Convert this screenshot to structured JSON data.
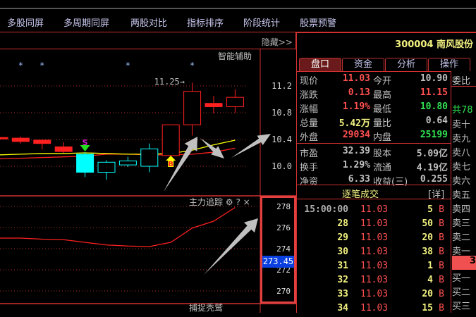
{
  "menu": [
    "多股同屏",
    "多周期同屏",
    "两股对比",
    "指标排序",
    "阶段统计",
    "股票预警"
  ],
  "hide_label": "隐藏>>",
  "main_chart": {
    "indicator_label": "智能辅助",
    "max_label": "11.25→",
    "signal_sell": "S",
    "signal_buy": "B",
    "colors": {
      "up": "#ff2020",
      "down": "#00ffff",
      "ma1": "#ffff00",
      "ma2": "#ff2020",
      "grid": "#b03030",
      "annot": "#c0c0c0"
    }
  },
  "chart_data": [
    {
      "type": "candlestick",
      "title": "智能辅助",
      "y_ticks": [
        "11.2",
        "10.8",
        "10.4",
        "10.0"
      ],
      "y_tick_values": [
        11.2,
        10.8,
        10.4,
        10.0
      ],
      "ylim": [
        9.73,
        11.72
      ],
      "candles": [
        {
          "o": 10.41,
          "h": 10.43,
          "l": 10.41,
          "c": 10.43,
          "color": "up",
          "filled": true
        },
        {
          "o": 10.37,
          "h": 10.44,
          "l": 10.34,
          "c": 10.42,
          "color": "up",
          "filled": true
        },
        {
          "o": 10.34,
          "h": 10.39,
          "l": 10.25,
          "c": 10.39,
          "color": "up",
          "filled": true
        },
        {
          "o": 10.22,
          "h": 10.36,
          "l": 10.2,
          "c": 10.29,
          "color": "up",
          "filled": true
        },
        {
          "o": 10.18,
          "h": 10.21,
          "l": 9.84,
          "c": 9.91,
          "color": "down",
          "filled": true
        },
        {
          "o": 10.06,
          "h": 10.09,
          "l": 9.8,
          "c": 9.91,
          "color": "down",
          "filled": false
        },
        {
          "o": 10.08,
          "h": 10.14,
          "l": 9.99,
          "c": 10.02,
          "color": "down",
          "filled": false
        },
        {
          "o": 10.26,
          "h": 10.34,
          "l": 9.91,
          "c": 10.0,
          "color": "down",
          "filled": false
        },
        {
          "o": 10.16,
          "h": 10.62,
          "l": 10.16,
          "c": 10.62,
          "color": "up",
          "filled": false
        },
        {
          "o": 10.62,
          "h": 11.25,
          "l": 10.46,
          "c": 11.12,
          "color": "up",
          "filled": false
        },
        {
          "o": 10.94,
          "h": 11.05,
          "l": 10.79,
          "c": 10.89,
          "color": "up",
          "filled": true
        },
        {
          "o": 10.89,
          "h": 11.15,
          "l": 10.8,
          "c": 11.03,
          "color": "up",
          "filled": false
        }
      ],
      "ma_yellow": [
        10.17,
        10.18,
        10.19,
        10.19,
        10.2,
        10.19,
        10.18,
        10.18,
        10.19,
        10.24,
        10.32,
        10.39
      ],
      "ma_red": [
        10.11,
        10.12,
        10.13,
        10.14,
        10.15,
        10.18,
        10.18,
        10.17,
        10.17,
        10.18,
        10.21,
        10.27
      ],
      "star_markers_at": [
        1,
        2,
        6,
        9
      ],
      "sell_signal_at": 4,
      "buy_signal_at": 8
    },
    {
      "type": "line",
      "title": "主力追踪",
      "y_ticks": [
        "278",
        "276",
        "274",
        "272",
        "270"
      ],
      "y_tick_values": [
        278,
        276,
        274,
        272,
        270
      ],
      "ylim": [
        269.1,
        278.97
      ],
      "current_value": "273.45",
      "values": [
        275.0,
        275.0,
        274.9,
        274.85,
        274.6,
        274.35,
        274.25,
        274.2,
        274.6,
        275.95,
        276.6,
        277.9
      ]
    }
  ],
  "sub_panel": {
    "title": "主力追踪",
    "settings_icon": "⚙",
    "help": "?",
    "close": "×",
    "next_title": "捕捉秃鹫"
  },
  "stock": {
    "code": "300004",
    "name": "南风股份"
  },
  "tabs": [
    "盘口",
    "资金",
    "分析",
    "操作"
  ],
  "quote": [
    {
      "l1": "现价",
      "v1": "11.03",
      "c1": "#ff5050",
      "l2": "今开",
      "v2": "10.90",
      "c2": "#c0c0c0"
    },
    {
      "l1": "涨跌",
      "v1": "0.13",
      "c1": "#ff5050",
      "l2": "最高",
      "v2": "11.15",
      "c2": "#ff5050"
    },
    {
      "l1": "涨幅",
      "v1": "1.19%",
      "c1": "#ff5050",
      "l2": "最低",
      "v2": "10.80",
      "c2": "#30e050"
    },
    {
      "l1": "总量",
      "v1": "5.42万",
      "c1": "#f0f080",
      "l2": "量比",
      "v2": "0.64",
      "c2": "#c0c0c0"
    },
    {
      "l1": "外盘",
      "v1": "29034",
      "c1": "#ff5050",
      "l2": "内盘",
      "v2": "25199",
      "c2": "#30e050"
    },
    {
      "l1": "市盈",
      "v1": "32.39",
      "c1": "#c0c0c0",
      "l2": "股本",
      "v2": "5.09亿",
      "c2": "#c0c0c0"
    },
    {
      "l1": "换手",
      "v1": "1.29%",
      "c1": "#c0c0c0",
      "l2": "流通",
      "v2": "4.19亿",
      "c2": "#c0c0c0"
    },
    {
      "l1": "净资",
      "v1": "6.33",
      "c1": "#c0c0c0",
      "l2": "收益(三)",
      "v2": "0.255",
      "c2": "#c0c0c0"
    }
  ],
  "trades_header": {
    "title": "逐笔成交",
    "detail": "[详]"
  },
  "trades": [
    {
      "time": "15:00:00",
      "price": "11.03",
      "vol": "5",
      "side": "B"
    },
    {
      "time": "28",
      "price": "11.03",
      "vol": "50",
      "side": "B"
    },
    {
      "time": "29",
      "price": "11.03",
      "vol": "20",
      "side": "B"
    },
    {
      "time": "30",
      "price": "11.03",
      "vol": "38",
      "side": "B"
    },
    {
      "time": "31",
      "price": "11.03",
      "vol": "1",
      "side": "B"
    },
    {
      "time": "32",
      "price": "11.03",
      "vol": "4",
      "side": "B"
    },
    {
      "time": "33",
      "price": "11.03",
      "vol": "20",
      "side": "B"
    },
    {
      "time": "34",
      "price": "11.03",
      "vol": "15",
      "side": "B"
    }
  ],
  "orderbook": {
    "header": "委比",
    "total": "共78",
    "levels": [
      "卖十",
      "卖九",
      "卖八",
      "卖七",
      "卖六",
      "卖五",
      "卖四",
      "卖三",
      "卖二",
      "卖一"
    ],
    "highlight": "3",
    "buy_levels": [
      "买一",
      "买二",
      "买三"
    ]
  }
}
